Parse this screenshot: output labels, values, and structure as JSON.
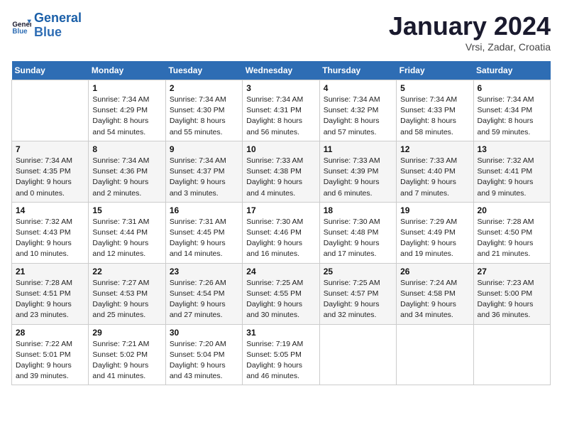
{
  "header": {
    "logo_line1": "General",
    "logo_line2": "Blue",
    "month_title": "January 2024",
    "location": "Vrsi, Zadar, Croatia"
  },
  "days_header": [
    "Sunday",
    "Monday",
    "Tuesday",
    "Wednesday",
    "Thursday",
    "Friday",
    "Saturday"
  ],
  "weeks": [
    [
      {
        "num": "",
        "info": ""
      },
      {
        "num": "1",
        "info": "Sunrise: 7:34 AM\nSunset: 4:29 PM\nDaylight: 8 hours\nand 54 minutes."
      },
      {
        "num": "2",
        "info": "Sunrise: 7:34 AM\nSunset: 4:30 PM\nDaylight: 8 hours\nand 55 minutes."
      },
      {
        "num": "3",
        "info": "Sunrise: 7:34 AM\nSunset: 4:31 PM\nDaylight: 8 hours\nand 56 minutes."
      },
      {
        "num": "4",
        "info": "Sunrise: 7:34 AM\nSunset: 4:32 PM\nDaylight: 8 hours\nand 57 minutes."
      },
      {
        "num": "5",
        "info": "Sunrise: 7:34 AM\nSunset: 4:33 PM\nDaylight: 8 hours\nand 58 minutes."
      },
      {
        "num": "6",
        "info": "Sunrise: 7:34 AM\nSunset: 4:34 PM\nDaylight: 8 hours\nand 59 minutes."
      }
    ],
    [
      {
        "num": "7",
        "info": "Sunrise: 7:34 AM\nSunset: 4:35 PM\nDaylight: 9 hours\nand 0 minutes."
      },
      {
        "num": "8",
        "info": "Sunrise: 7:34 AM\nSunset: 4:36 PM\nDaylight: 9 hours\nand 2 minutes."
      },
      {
        "num": "9",
        "info": "Sunrise: 7:34 AM\nSunset: 4:37 PM\nDaylight: 9 hours\nand 3 minutes."
      },
      {
        "num": "10",
        "info": "Sunrise: 7:33 AM\nSunset: 4:38 PM\nDaylight: 9 hours\nand 4 minutes."
      },
      {
        "num": "11",
        "info": "Sunrise: 7:33 AM\nSunset: 4:39 PM\nDaylight: 9 hours\nand 6 minutes."
      },
      {
        "num": "12",
        "info": "Sunrise: 7:33 AM\nSunset: 4:40 PM\nDaylight: 9 hours\nand 7 minutes."
      },
      {
        "num": "13",
        "info": "Sunrise: 7:32 AM\nSunset: 4:41 PM\nDaylight: 9 hours\nand 9 minutes."
      }
    ],
    [
      {
        "num": "14",
        "info": "Sunrise: 7:32 AM\nSunset: 4:43 PM\nDaylight: 9 hours\nand 10 minutes."
      },
      {
        "num": "15",
        "info": "Sunrise: 7:31 AM\nSunset: 4:44 PM\nDaylight: 9 hours\nand 12 minutes."
      },
      {
        "num": "16",
        "info": "Sunrise: 7:31 AM\nSunset: 4:45 PM\nDaylight: 9 hours\nand 14 minutes."
      },
      {
        "num": "17",
        "info": "Sunrise: 7:30 AM\nSunset: 4:46 PM\nDaylight: 9 hours\nand 16 minutes."
      },
      {
        "num": "18",
        "info": "Sunrise: 7:30 AM\nSunset: 4:48 PM\nDaylight: 9 hours\nand 17 minutes."
      },
      {
        "num": "19",
        "info": "Sunrise: 7:29 AM\nSunset: 4:49 PM\nDaylight: 9 hours\nand 19 minutes."
      },
      {
        "num": "20",
        "info": "Sunrise: 7:28 AM\nSunset: 4:50 PM\nDaylight: 9 hours\nand 21 minutes."
      }
    ],
    [
      {
        "num": "21",
        "info": "Sunrise: 7:28 AM\nSunset: 4:51 PM\nDaylight: 9 hours\nand 23 minutes."
      },
      {
        "num": "22",
        "info": "Sunrise: 7:27 AM\nSunset: 4:53 PM\nDaylight: 9 hours\nand 25 minutes."
      },
      {
        "num": "23",
        "info": "Sunrise: 7:26 AM\nSunset: 4:54 PM\nDaylight: 9 hours\nand 27 minutes."
      },
      {
        "num": "24",
        "info": "Sunrise: 7:25 AM\nSunset: 4:55 PM\nDaylight: 9 hours\nand 30 minutes."
      },
      {
        "num": "25",
        "info": "Sunrise: 7:25 AM\nSunset: 4:57 PM\nDaylight: 9 hours\nand 32 minutes."
      },
      {
        "num": "26",
        "info": "Sunrise: 7:24 AM\nSunset: 4:58 PM\nDaylight: 9 hours\nand 34 minutes."
      },
      {
        "num": "27",
        "info": "Sunrise: 7:23 AM\nSunset: 5:00 PM\nDaylight: 9 hours\nand 36 minutes."
      }
    ],
    [
      {
        "num": "28",
        "info": "Sunrise: 7:22 AM\nSunset: 5:01 PM\nDaylight: 9 hours\nand 39 minutes."
      },
      {
        "num": "29",
        "info": "Sunrise: 7:21 AM\nSunset: 5:02 PM\nDaylight: 9 hours\nand 41 minutes."
      },
      {
        "num": "30",
        "info": "Sunrise: 7:20 AM\nSunset: 5:04 PM\nDaylight: 9 hours\nand 43 minutes."
      },
      {
        "num": "31",
        "info": "Sunrise: 7:19 AM\nSunset: 5:05 PM\nDaylight: 9 hours\nand 46 minutes."
      },
      {
        "num": "",
        "info": ""
      },
      {
        "num": "",
        "info": ""
      },
      {
        "num": "",
        "info": ""
      }
    ]
  ]
}
